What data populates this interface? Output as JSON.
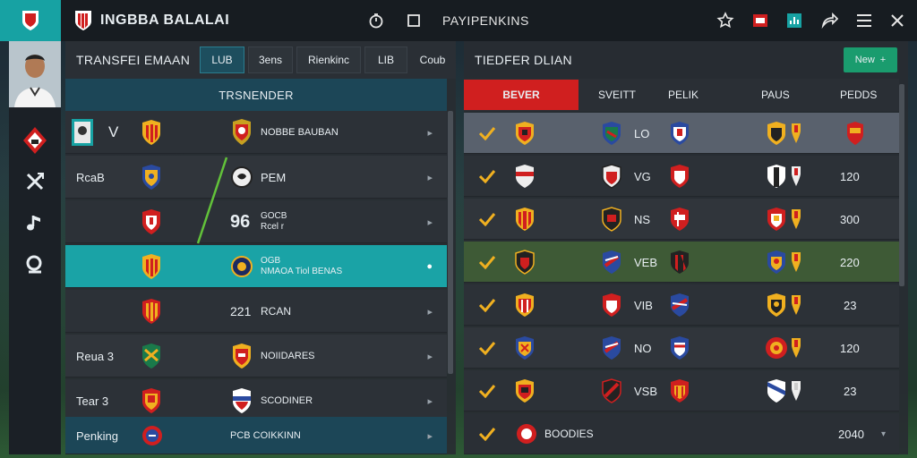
{
  "app": {
    "title": "INGBBA BALALAI"
  },
  "toolbar": {
    "ranking_label": "PAYIPENKINS"
  },
  "left_panel": {
    "title": "TRANSFEI EMAAN",
    "tabs": [
      "LUB",
      "3ens",
      "Rienkinc",
      "LIB",
      "Coub"
    ],
    "subheader": "TRSNENDER",
    "rows": [
      {
        "label": "",
        "check": "V",
        "name": "NOBBE BAUBAN",
        "num": "",
        "sub": ""
      },
      {
        "label": "RcaB",
        "name": "PEM",
        "num": "",
        "sub": ""
      },
      {
        "label": "",
        "name": "GOCB",
        "num": "96",
        "sub": "Rcel r"
      },
      {
        "label": "",
        "name": "OGB",
        "num": "",
        "sub": "NMAOA Tiol BENAS"
      },
      {
        "label": "",
        "name": "RCAN",
        "num": "221",
        "sub": ""
      },
      {
        "label": "Reua 3",
        "name": "NOIIDARES",
        "num": "",
        "sub": ""
      },
      {
        "label": "Tear 3",
        "name": "SCODINER",
        "num": "",
        "sub": ""
      },
      {
        "label": "Penking",
        "name": "PCB COIKKINN",
        "num": "",
        "sub": ""
      }
    ]
  },
  "right_panel": {
    "title": "TIEDFER DLIAN",
    "new_button": "New",
    "headers": [
      "BEVER",
      "SVEITT",
      "PELIK",
      "PAUS",
      "PEDDS"
    ],
    "rows": [
      {
        "code": "LO",
        "value": ""
      },
      {
        "code": "VG",
        "value": "120"
      },
      {
        "code": "NS",
        "value": "300"
      },
      {
        "code": "VEB",
        "value": "220"
      },
      {
        "code": "VIB",
        "value": "23"
      },
      {
        "code": "NO",
        "value": "120"
      },
      {
        "code": "VSB",
        "value": "23"
      },
      {
        "code": "BOODIES",
        "value": "2040"
      }
    ]
  },
  "colors": {
    "accent": "#17a2a3",
    "danger": "#d01f1f",
    "check": "#f0b020"
  }
}
